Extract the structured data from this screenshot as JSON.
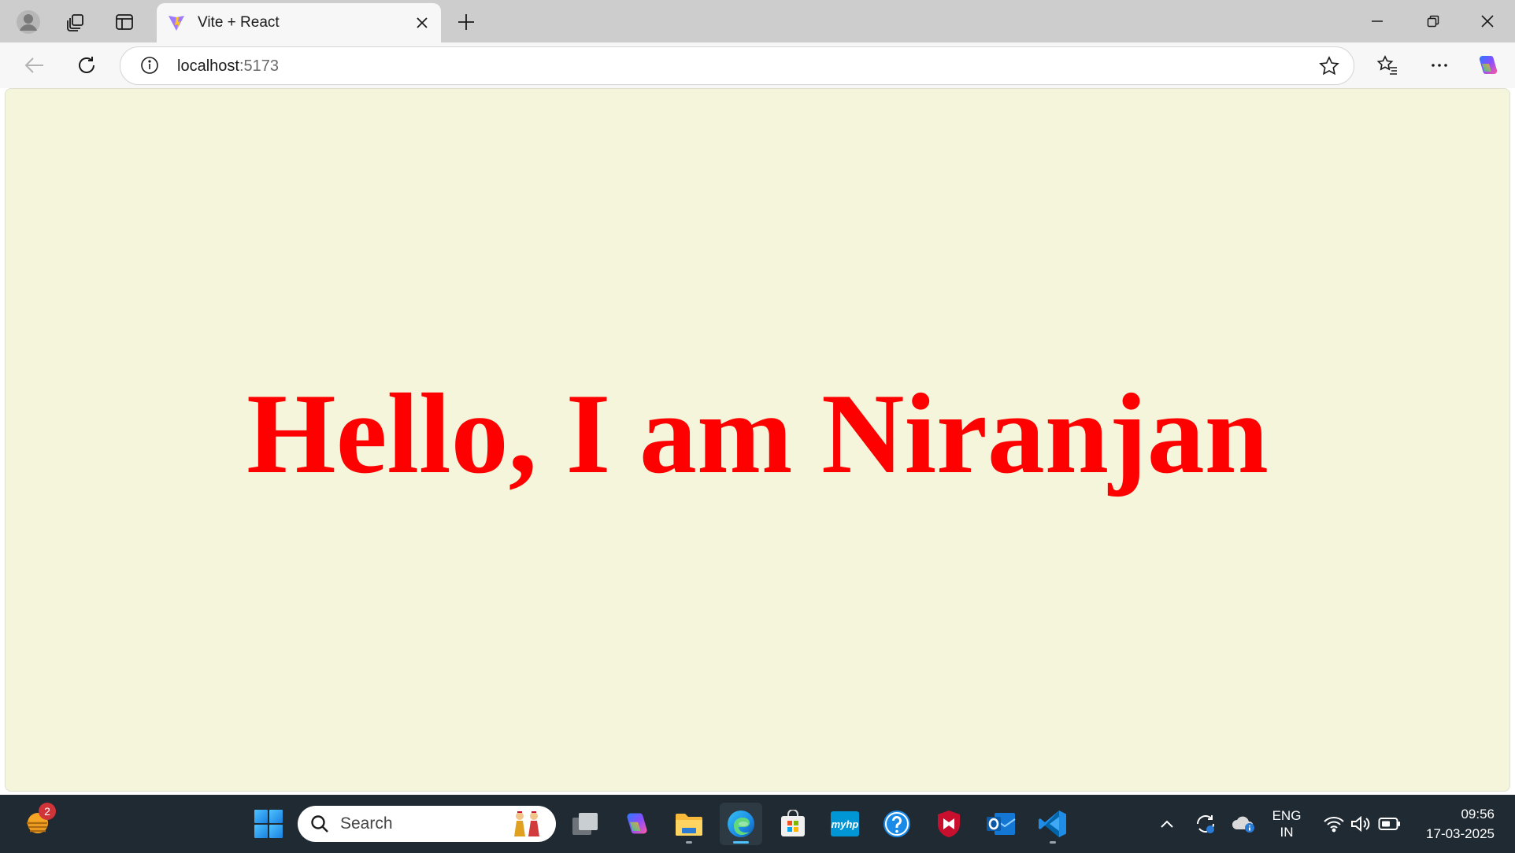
{
  "browser": {
    "tab": {
      "title": "Vite + React"
    },
    "omnibox": {
      "host": "localhost",
      "port": ":5173"
    },
    "window_buttons": [
      "minimize",
      "restore",
      "close"
    ]
  },
  "page": {
    "background_color": "#f5f5dc",
    "heading": "Hello, I am Niranjan",
    "heading_color": "#ff0000"
  },
  "taskbar": {
    "weather_badge": "2",
    "search_placeholder": "Search",
    "apps": [
      "start",
      "task-view",
      "copilot",
      "file-explorer",
      "edge",
      "microsoft-store",
      "myhp",
      "get-help",
      "mcafee",
      "outlook",
      "vscode"
    ],
    "language": {
      "line1": "ENG",
      "line2": "IN"
    },
    "clock": {
      "time": "09:56",
      "date": "17-03-2025"
    }
  }
}
